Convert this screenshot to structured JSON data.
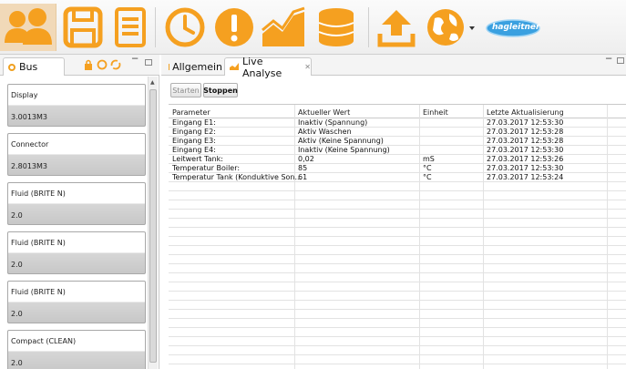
{
  "toolbar": {
    "icons": [
      "users-icon",
      "save-icon",
      "document-icon",
      "clock-icon",
      "warning-icon",
      "chart-icon",
      "database-icon",
      "upload-icon",
      "globe-icon"
    ],
    "brand": "hagleitner",
    "accent_color": "#f5a020"
  },
  "left_panel": {
    "tab_label": "Bus",
    "items": [
      {
        "name": "Display",
        "value": "3.0013M3"
      },
      {
        "name": "Connector",
        "value": "2.8013M3"
      },
      {
        "name": "Fluid (BRITE N)",
        "value": "2.0"
      },
      {
        "name": "Fluid (BRITE N)",
        "value": "2.0"
      },
      {
        "name": "Fluid (BRITE N)",
        "value": "2.0"
      },
      {
        "name": "Compact (CLEAN)",
        "value": "2.0"
      }
    ]
  },
  "right_panel": {
    "tabs": [
      {
        "label": "Allgemein"
      },
      {
        "label": "Live Analyse",
        "close": "✕"
      }
    ],
    "buttons": {
      "start": "Starten",
      "stop": "Stoppen"
    },
    "table": {
      "headers": [
        "Parameter",
        "Aktueller Wert",
        "Einheit",
        "Letzte Aktualisierung"
      ],
      "rows": [
        [
          "Eingang E1:",
          "Inaktiv (Spannung)",
          "",
          "27.03.2017 12:53:30"
        ],
        [
          "Eingang E2:",
          "Aktiv Waschen",
          "",
          "27.03.2017 12:53:28"
        ],
        [
          "Eingang E3:",
          "Aktiv (Keine Spannung)",
          "",
          "27.03.2017 12:53:28"
        ],
        [
          "Eingang E4:",
          "Inaktiv (Keine Spannung)",
          "",
          "27.03.2017 12:53:30"
        ],
        [
          "Leitwert Tank:",
          "0,02",
          "mS",
          "27.03.2017 12:53:26"
        ],
        [
          "Temperatur Boiler:",
          "85",
          "°C",
          "27.03.2017 12:53:30"
        ],
        [
          "Temperatur Tank (Konduktive Son...",
          "61",
          "°C",
          "27.03.2017 12:53:24"
        ]
      ]
    }
  }
}
